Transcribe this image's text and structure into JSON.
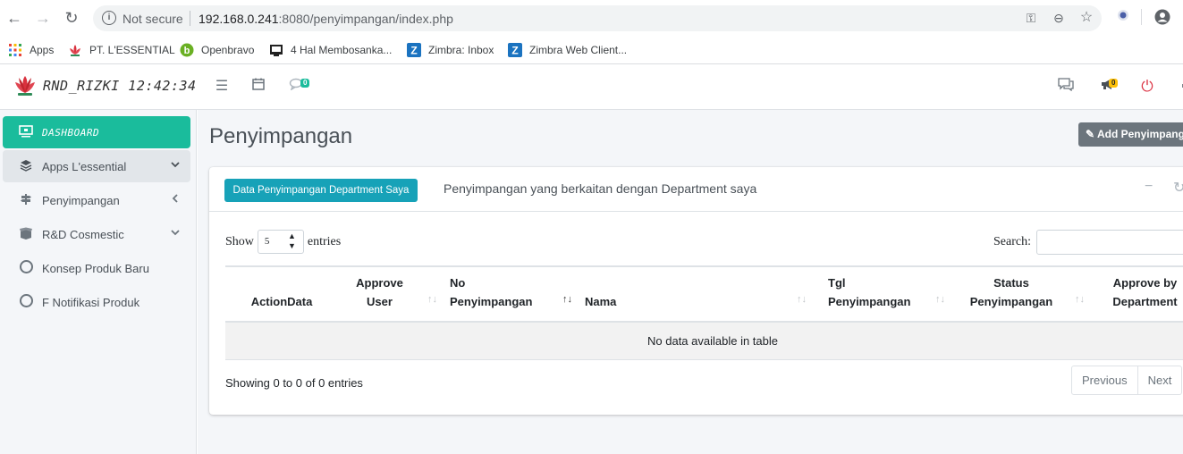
{
  "browser": {
    "security": "Not secure",
    "url_host": "192.168.0.241",
    "url_rest": ":8080/penyimpangan/index.php",
    "bookmarks": [
      {
        "label": "Apps",
        "icon": "apps-grid-icon"
      },
      {
        "label": "PT. L'ESSENTIAL",
        "icon": "lotus-icon"
      },
      {
        "label": "Openbravo",
        "icon": "openbravo-icon"
      },
      {
        "label": "4 Hal Membosanka...",
        "icon": "page-icon"
      },
      {
        "label": "Zimbra: Inbox",
        "icon": "zimbra-icon"
      },
      {
        "label": "Zimbra Web Client...",
        "icon": "zimbra-icon"
      }
    ]
  },
  "header": {
    "brand": "RND_RIZKI  12:42:34",
    "notif_count": "0",
    "announce_count": "0"
  },
  "sidebar": {
    "items": [
      {
        "label": "DASHBOARD",
        "icon": "monitor-icon"
      },
      {
        "label": "Apps L'essential",
        "icon": "layers-icon"
      },
      {
        "label": "Penyimpangan",
        "icon": "signpost-icon"
      },
      {
        "label": "R&D Cosmestic",
        "icon": "box-open-icon"
      },
      {
        "label": "Konsep Produk Baru",
        "icon": "circle-icon"
      },
      {
        "label": "F Notifikasi Produk",
        "icon": "circle-icon"
      }
    ]
  },
  "main": {
    "title": "Penyimpangan",
    "add_button": "Add Penyimpangan",
    "tab_button": "Data Penyimpangan Department Saya",
    "subtitle": "Penyimpangan yang berkaitan dengan Department saya",
    "show_label": "Show",
    "entries_value": "5",
    "entries_label": "entries",
    "search_label": "Search:",
    "columns": [
      {
        "line1": "",
        "line2": "ActionData"
      },
      {
        "line1": "Approve",
        "line2": "User"
      },
      {
        "line1": "No",
        "line2": "Penyimpangan"
      },
      {
        "line1": "",
        "line2": "Nama"
      },
      {
        "line1": "Tgl",
        "line2": "Penyimpangan"
      },
      {
        "line1": "Status",
        "line2": "Penyimpangan"
      },
      {
        "line1": "Approve by",
        "line2": "Department"
      }
    ],
    "empty_text": "No data available in table",
    "info": "Showing 0 to 0 of 0 entries",
    "prev": "Previous",
    "next": "Next"
  },
  "colors": {
    "accent": "#1abc9c",
    "info": "#17a2b8",
    "secondary": "#6c757d"
  }
}
